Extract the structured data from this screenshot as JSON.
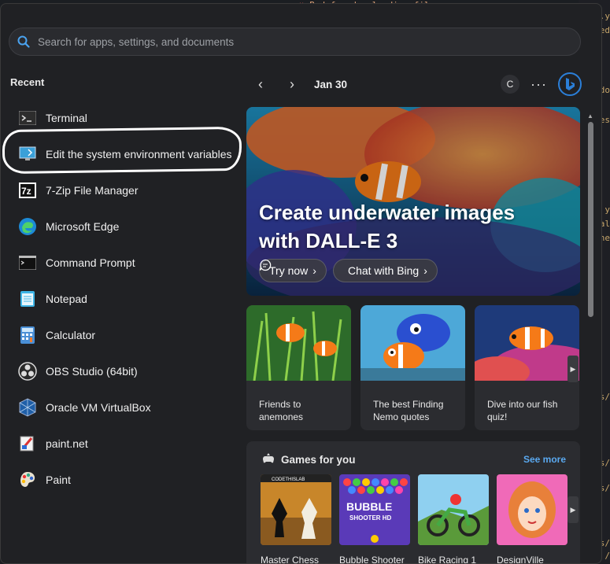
{
  "background": {
    "top_text": "Bad for downloading files",
    "side_snippets": [
      ".y",
      "ed",
      "do",
      "es",
      "y",
      "al",
      "he",
      "s/",
      "s/",
      "s/",
      "s/",
      "/"
    ]
  },
  "search": {
    "placeholder": "Search for apps, settings, and documents",
    "icon": "search-icon"
  },
  "recent": {
    "title": "Recent",
    "items": [
      {
        "label": "Terminal",
        "icon": "terminal-icon"
      },
      {
        "label": "Edit the system environment variables",
        "icon": "system-properties-icon"
      },
      {
        "label": "7-Zip File Manager",
        "icon": "7zip-icon"
      },
      {
        "label": "Microsoft Edge",
        "icon": "edge-icon"
      },
      {
        "label": "Command Prompt",
        "icon": "cmd-icon"
      },
      {
        "label": "Notepad",
        "icon": "notepad-icon"
      },
      {
        "label": "Calculator",
        "icon": "calculator-icon"
      },
      {
        "label": "OBS Studio (64bit)",
        "icon": "obs-icon"
      },
      {
        "label": "Oracle VM VirtualBox",
        "icon": "virtualbox-icon"
      },
      {
        "label": "paint.net",
        "icon": "paintdotnet-icon"
      },
      {
        "label": "Paint",
        "icon": "paint-icon"
      }
    ]
  },
  "feed": {
    "date": "Jan 30",
    "avatar_initial": "C",
    "more_label": "···"
  },
  "hero": {
    "title": "Create underwater images with DALL-E 3",
    "try_now": "Try now",
    "chat_bing": "Chat with Bing"
  },
  "tiles": [
    {
      "caption": "Friends to anemones"
    },
    {
      "caption": "The best Finding Nemo quotes"
    },
    {
      "caption": "Dive into our fish quiz!"
    }
  ],
  "games": {
    "title": "Games for you",
    "see_more": "See more",
    "items": [
      {
        "name": "Master Chess"
      },
      {
        "name": "Bubble Shooter HD"
      },
      {
        "name": "Bike Racing 1"
      },
      {
        "name": "DesignVille"
      }
    ]
  },
  "colors": {
    "panel": "#202124",
    "accent_link": "#5aa9f0",
    "bing_blue": "#2b7fd8"
  }
}
